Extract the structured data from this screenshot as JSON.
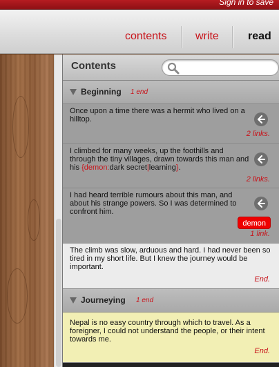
{
  "topbar": {
    "signin_label": "Sign in to save"
  },
  "nav": {
    "contents_label": "contents",
    "write_label": "write",
    "read_label": "read"
  },
  "panel": {
    "title": "Contents",
    "search_placeholder": ""
  },
  "sections": [
    {
      "name": "Beginning",
      "count": "1 end",
      "entries": [
        {
          "text": "Once upon a time there was a hermit who lived on a hilltop.",
          "links": "2 links."
        },
        {
          "text_before": "I climbed for many weeks, up the foothills and through the tiny villages, drawn towards this man and his ",
          "text_red1": "{demon:",
          "text_mid": "dark secret",
          "text_red2": "|",
          "text_mid2": "learning",
          "text_red3": "}",
          "text_after": ".",
          "links": "2 links."
        },
        {
          "text": "I had heard terrible rumours about this man, and about his strange powers. So I was determined to confront him.",
          "tag": "demon",
          "links": "1 link."
        },
        {
          "text": "The climb was slow, arduous and hard. I had never been so tired in my short life. But I knew the journey would be important.",
          "links": "End."
        }
      ]
    },
    {
      "name": "Journeying",
      "count": "1 end",
      "entries": [
        {
          "text": "Nepal is no easy country through which to travel. As a foreigner, I could not understand the people, or their intent towards me.",
          "links": "End."
        }
      ]
    }
  ],
  "colors": {
    "accent": "#c8141b",
    "highlight": "#f2efb4"
  }
}
